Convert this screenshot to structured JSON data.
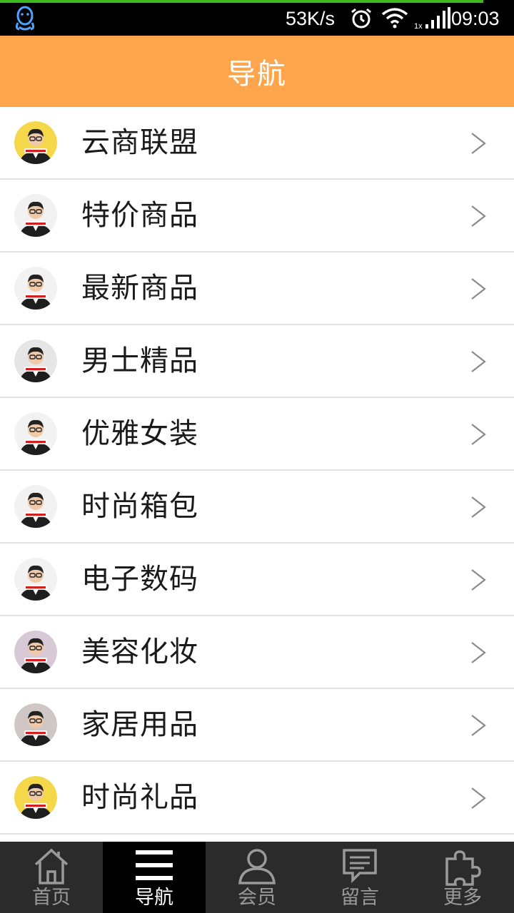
{
  "status_bar": {
    "network_speed": "53K/s",
    "signal_note": "1x",
    "time": "09:03",
    "download_progress": 0.94,
    "icons": [
      "qq-icon",
      "alarm-icon",
      "wifi-icon",
      "signal-icon"
    ]
  },
  "header": {
    "title": "导航"
  },
  "nav_list": {
    "items": [
      {
        "label": "云商联盟",
        "avatar_bg": "#f5d74a"
      },
      {
        "label": "特价商品",
        "avatar_bg": "#f2f2f2"
      },
      {
        "label": "最新商品",
        "avatar_bg": "#f2f2f2"
      },
      {
        "label": "男士精品",
        "avatar_bg": "#e6e6e6"
      },
      {
        "label": "优雅女装",
        "avatar_bg": "#f2f2f2"
      },
      {
        "label": "时尚箱包",
        "avatar_bg": "#f2f2f2"
      },
      {
        "label": "电子数码",
        "avatar_bg": "#f2f2f2"
      },
      {
        "label": "美容化妆",
        "avatar_bg": "#d8c9d6"
      },
      {
        "label": "家居用品",
        "avatar_bg": "#cfc6c6"
      },
      {
        "label": "时尚礼品",
        "avatar_bg": "#f5d74a"
      }
    ],
    "chevron": ">"
  },
  "bottom_nav": {
    "tabs": [
      {
        "label": "首页",
        "icon": "home-icon",
        "active": false
      },
      {
        "label": "导航",
        "icon": "menu-icon",
        "active": true
      },
      {
        "label": "会员",
        "icon": "user-icon",
        "active": false
      },
      {
        "label": "留言",
        "icon": "message-icon",
        "active": false
      },
      {
        "label": "更多",
        "icon": "puzzle-icon",
        "active": false
      }
    ]
  },
  "colors": {
    "header_bg": "#ffa64c",
    "status_bg": "#000000",
    "progress": "#3db81f",
    "bottom_bg": "#2b2b2b",
    "active_tab_bg": "#000000",
    "divider": "#e2e2e2"
  }
}
